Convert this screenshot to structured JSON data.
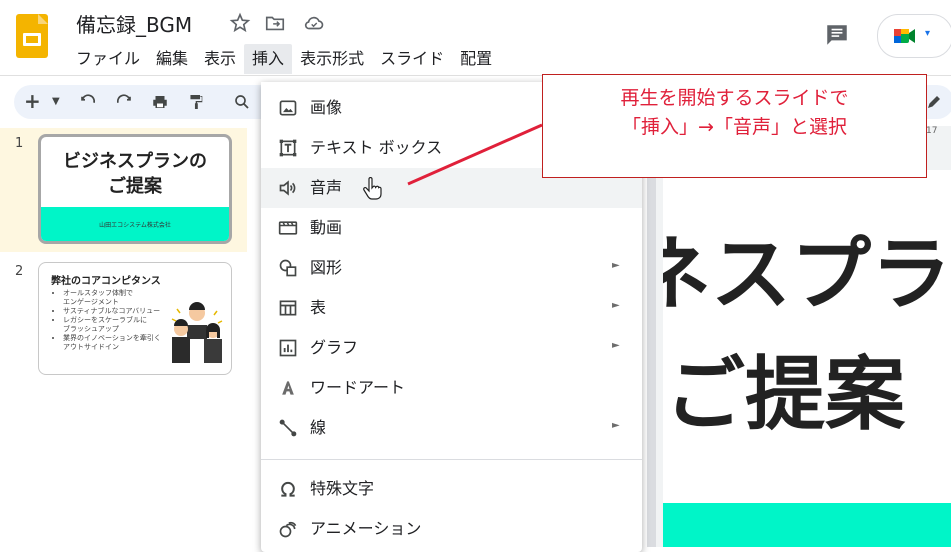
{
  "doc": {
    "title": "備忘録_BGM"
  },
  "menubar": [
    "ファイル",
    "編集",
    "表示",
    "挿入",
    "表示形式",
    "スライド",
    "配置"
  ],
  "menubar_active_index": 3,
  "slides": [
    {
      "number": "1",
      "title_line1": "ビジネスプランの",
      "title_line2": "ご提案",
      "footer": "山田エコシステム株式会社"
    },
    {
      "number": "2",
      "heading": "弊社のコアコンピタンス",
      "bullets": [
        "オールスタッフ体制で",
        "エンゲージメント",
        "サスティナブルなコアバリュー",
        "レガシーをスケーラブルに",
        "ブラッシュアップ",
        "業界のイノベーションを牽引く",
        "アウトサイドイン"
      ]
    }
  ],
  "canvas": {
    "line1": "ネスプラ",
    "line2": "ご提案",
    "ruler_mark": "17"
  },
  "insert_menu": {
    "items": [
      {
        "label": "画像",
        "icon": "image-icon",
        "submenu": false
      },
      {
        "label": "テキスト ボックス",
        "icon": "textbox-icon",
        "submenu": false
      },
      {
        "label": "音声",
        "icon": "audio-icon",
        "submenu": false,
        "hovered": true
      },
      {
        "label": "動画",
        "icon": "video-icon",
        "submenu": false
      },
      {
        "label": "図形",
        "icon": "shapes-icon",
        "submenu": true
      },
      {
        "label": "表",
        "icon": "table-icon",
        "submenu": true
      },
      {
        "label": "グラフ",
        "icon": "chart-icon",
        "submenu": true
      },
      {
        "label": "ワードアート",
        "icon": "wordart-icon",
        "submenu": false
      },
      {
        "label": "線",
        "icon": "line-icon",
        "submenu": true
      },
      {
        "label": "特殊文字",
        "icon": "omega-icon",
        "submenu": false
      },
      {
        "label": "アニメーション",
        "icon": "animation-icon",
        "submenu": false
      }
    ],
    "submenu_arrow": "►"
  },
  "annotation": {
    "line1": "再生を開始するスライドで",
    "line2": "「挿入」→「音声」と選択",
    "color": "#e0203a"
  },
  "colors": {
    "accent_band": "#00f5c8",
    "logo": "#F4B400",
    "selected_slide": "#fef7e0"
  }
}
